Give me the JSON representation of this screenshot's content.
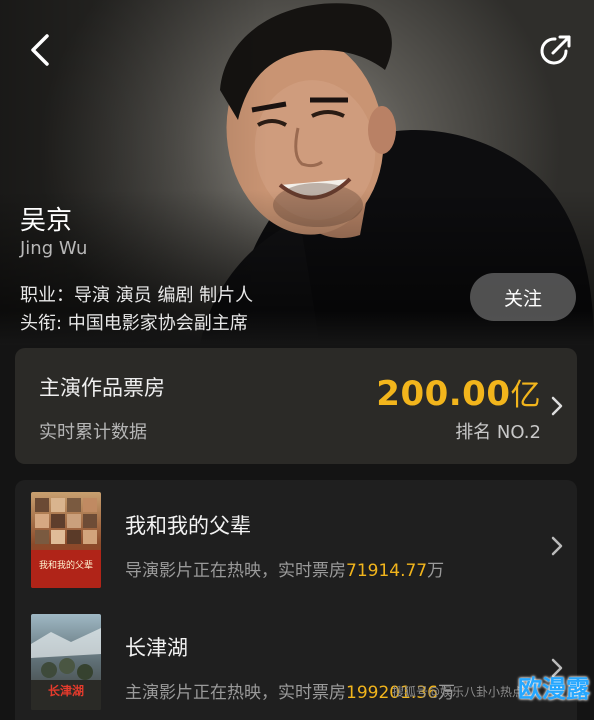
{
  "header": {
    "back_icon": "chevron-left-icon",
    "share_icon": "share-icon"
  },
  "profile": {
    "name": "吴京",
    "name_en": "Jing Wu",
    "occupation": "职业：导演 演员 编剧 制片人",
    "title": "头衔: 中国电影家协会副主席",
    "follow_label": "关注"
  },
  "box_office": {
    "title": "主演作品票房",
    "subtitle": "实时累计数据",
    "value": "200.00",
    "unit": "亿",
    "rank": "排名 NO.2"
  },
  "works": [
    {
      "title": "我和我的父辈",
      "status": "导演影片正在热映，实时票房",
      "amount": "71914.77",
      "unit": "万",
      "poster_text": "我和我的父辈"
    },
    {
      "title": "长津湖",
      "status": "主演影片正在热映，实时票房",
      "amount": "199201.36",
      "unit": "万",
      "poster_text": "长津湖"
    }
  ],
  "watermark": "搜狐号@娱乐八卦小热点",
  "corner_logo": "欧漫露",
  "colors": {
    "accent": "#f2b51c",
    "background": "#141414",
    "card": "#2b2a27"
  }
}
